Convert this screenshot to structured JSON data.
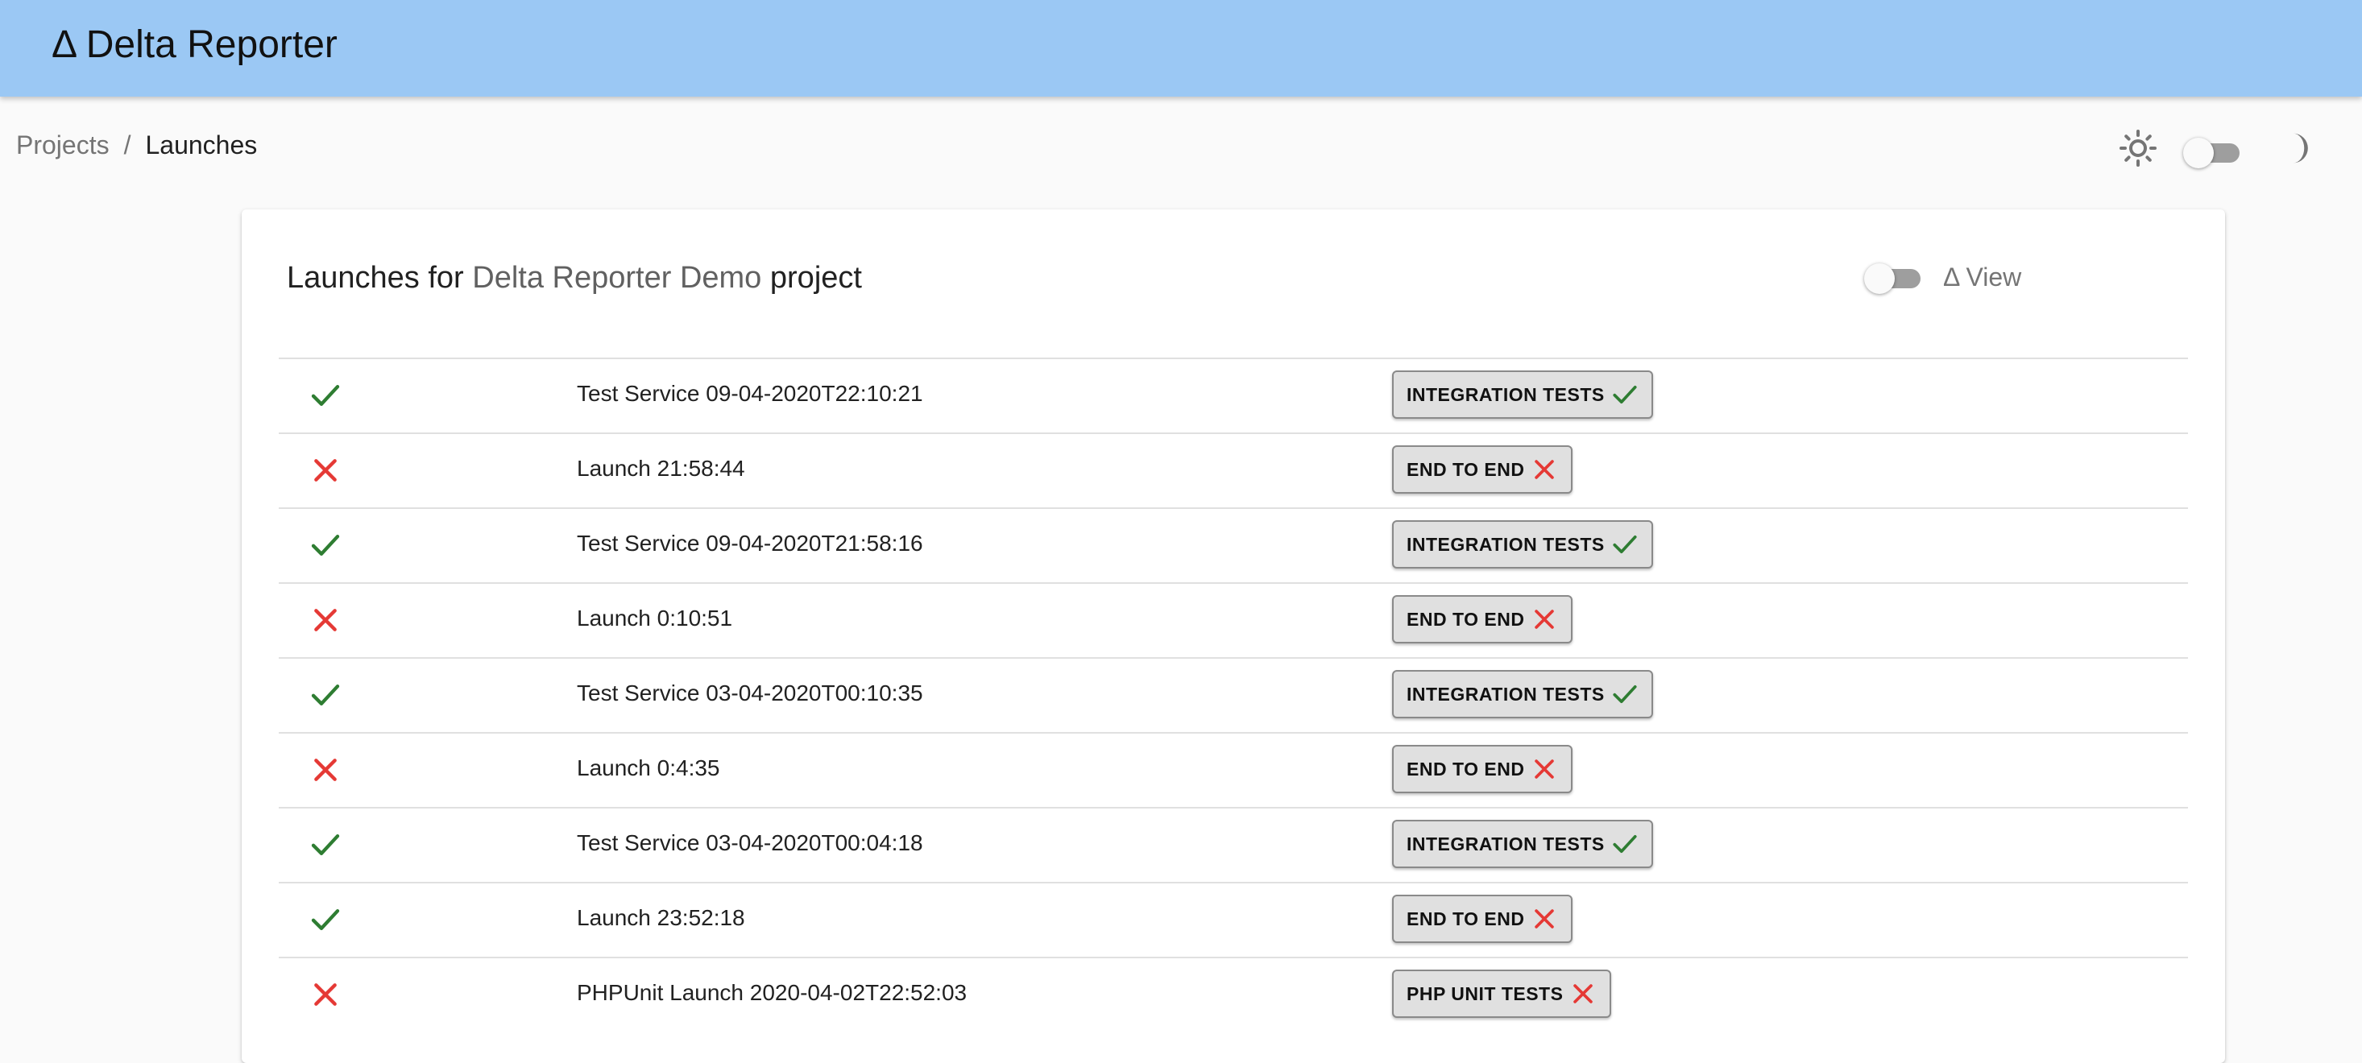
{
  "app": {
    "title": "Δ Delta Reporter"
  },
  "breadcrumb": {
    "items": [
      "Projects",
      "Launches"
    ],
    "separator": "/"
  },
  "theme": {
    "light_icon": "sun-icon",
    "dark_icon": "moon-icon",
    "dark_mode": false
  },
  "header": {
    "prefix": "Launches for",
    "project": "Delta Reporter Demo",
    "suffix": "project",
    "delta_view_label": "Δ View",
    "delta_view_enabled": false
  },
  "colors": {
    "app_bar": "#9bc8f4",
    "passed": "#2e7d32",
    "failed": "#e53935"
  },
  "launches": [
    {
      "status": "passed",
      "name": "Test Service 09-04-2020T22:10:21",
      "test_type": "INTEGRATION TESTS",
      "test_status": "passed"
    },
    {
      "status": "failed",
      "name": "Launch 21:58:44",
      "test_type": "END TO END",
      "test_status": "failed"
    },
    {
      "status": "passed",
      "name": "Test Service 09-04-2020T21:58:16",
      "test_type": "INTEGRATION TESTS",
      "test_status": "passed"
    },
    {
      "status": "failed",
      "name": "Launch 0:10:51",
      "test_type": "END TO END",
      "test_status": "failed"
    },
    {
      "status": "passed",
      "name": "Test Service 03-04-2020T00:10:35",
      "test_type": "INTEGRATION TESTS",
      "test_status": "passed"
    },
    {
      "status": "failed",
      "name": "Launch 0:4:35",
      "test_type": "END TO END",
      "test_status": "failed"
    },
    {
      "status": "passed",
      "name": "Test Service 03-04-2020T00:04:18",
      "test_type": "INTEGRATION TESTS",
      "test_status": "passed"
    },
    {
      "status": "passed",
      "name": "Launch 23:52:18",
      "test_type": "END TO END",
      "test_status": "failed"
    },
    {
      "status": "failed",
      "name": "PHPUnit Launch 2020-04-02T22:52:03",
      "test_type": "PHP UNIT TESTS",
      "test_status": "failed"
    }
  ]
}
